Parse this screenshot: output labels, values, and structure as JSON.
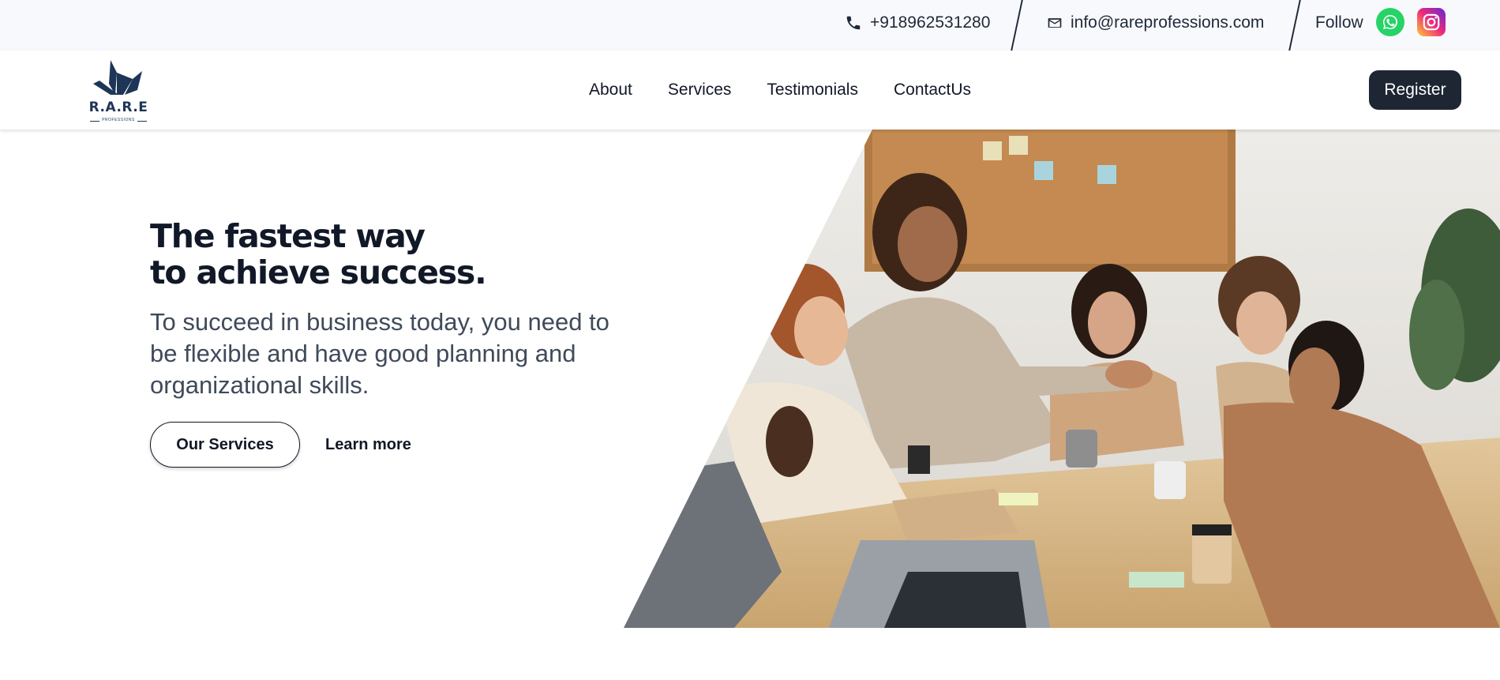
{
  "topbar": {
    "phone": "+918962531280",
    "email": "info@rareprofessions.com",
    "follow_label": "Follow"
  },
  "logo": {
    "text": "R.A.R.E",
    "subtext": "PROFESSIONS"
  },
  "nav": {
    "links": [
      "About",
      "Services",
      "Testimonials",
      "ContactUs"
    ],
    "register_label": "Register"
  },
  "hero": {
    "title_line1": "The fastest way",
    "title_line2": "to achieve success.",
    "description": "To succeed in business today, you need to be flexible and have good planning and organizational skills.",
    "primary_button": "Our Services",
    "secondary_link": "Learn more"
  },
  "colors": {
    "topbar_bg": "#f8f9fd",
    "accent_dark": "#1e2633",
    "logo_navy": "#1e3557",
    "whatsapp_green": "#25d366"
  },
  "icons": [
    "phone-icon",
    "mail-icon",
    "whatsapp-icon",
    "instagram-icon"
  ]
}
